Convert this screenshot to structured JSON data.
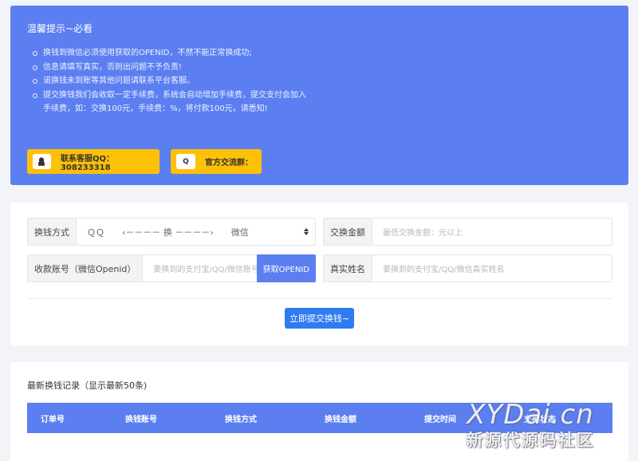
{
  "notice": {
    "title": "温馨提示~必看",
    "items": [
      "换钱到微信必须使用获取的OPENID，不然不能正常换成功;",
      "信息请填写真实，否则出问题不予负责!",
      "诺换钱未到账等其他问题请联系平台客服。",
      "提交换钱我们会收取一定手续费，系统会自动增加手续费，提交支付会加入手续费，如：交换100元，手续费：%，将付款100元，请悉知!"
    ],
    "qq_button": "联系客服QQ：308233318",
    "qq_icon": "Q",
    "group_button": "官方交流群："
  },
  "form": {
    "method_label": "换钱方式",
    "method_value": "ＱＱ　　‹－－－－ 换 －－－－›　　微信",
    "amount_label": "交换金额",
    "amount_placeholder": "最低交换金额：元以上",
    "account_label": "收款账号（微信Openid）",
    "account_placeholder": "要换到的支付宝/QQ/微信账号",
    "get_openid_button": "获取OPENID",
    "name_label": "真实姓名",
    "name_placeholder": "要换到的支付宝/QQ/微信真实姓名",
    "submit_button": "立即提交换钱~"
  },
  "records": {
    "title": "最新换钱记录（显示最新50条)",
    "columns": [
      "订单号",
      "换钱账号",
      "换钱方式",
      "换钱金额",
      "提交时间",
      "交换状态"
    ]
  },
  "watermark": {
    "line1": "XYDai.cn",
    "line2": "新源代源码社区"
  }
}
